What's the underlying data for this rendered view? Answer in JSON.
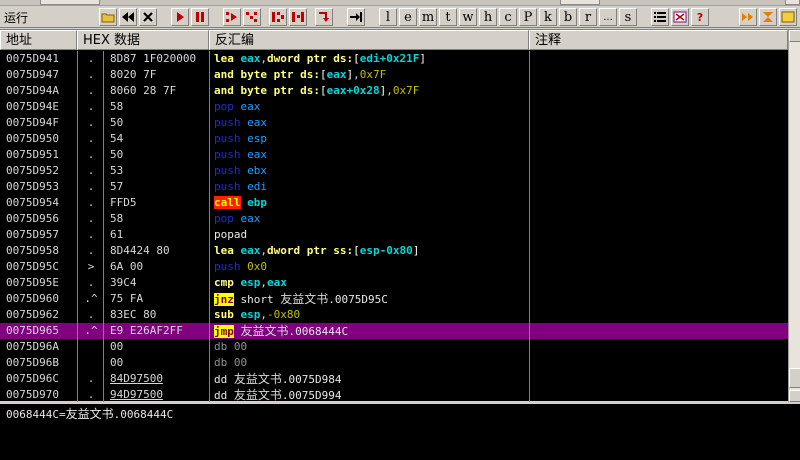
{
  "toolbar": {
    "status": "运行",
    "letters": [
      "l",
      "e",
      "m",
      "t",
      "w",
      "h",
      "c",
      "P",
      "k",
      "b",
      "r",
      "...",
      "s"
    ]
  },
  "columns": {
    "address": "地址",
    "hex": "HEX 数据",
    "disasm": "反汇编",
    "comment": "注释"
  },
  "rows": [
    {
      "addr": "0075D941",
      "mark": ".",
      "hex": "8D87 1F020000",
      "asm": [
        [
          "kw",
          "lea "
        ],
        [
          "reg",
          "eax"
        ],
        [
          "sep",
          ","
        ],
        [
          "kw",
          "dword ptr ds:"
        ],
        [
          "op",
          "["
        ],
        [
          "reg",
          "edi+0x21F"
        ],
        [
          "op",
          "]"
        ]
      ]
    },
    {
      "addr": "0075D947",
      "mark": ".",
      "hex": "8020 7F",
      "asm": [
        [
          "kw",
          "and "
        ],
        [
          "kw",
          "byte ptr ds:"
        ],
        [
          "op",
          "["
        ],
        [
          "reg",
          "eax"
        ],
        [
          "op",
          "]"
        ],
        [
          "sep",
          ","
        ],
        [
          "num",
          "0x7F"
        ]
      ]
    },
    {
      "addr": "0075D94A",
      "mark": ".",
      "hex": "8060 28 7F",
      "asm": [
        [
          "kw",
          "and "
        ],
        [
          "kw",
          "byte ptr ds:"
        ],
        [
          "op",
          "["
        ],
        [
          "reg",
          "eax+0x28"
        ],
        [
          "op",
          "]"
        ],
        [
          "sep",
          ","
        ],
        [
          "num",
          "0x7F"
        ]
      ]
    },
    {
      "addr": "0075D94E",
      "mark": ".",
      "hex": "58",
      "asm": [
        [
          "stack",
          "pop "
        ],
        [
          "stk-reg",
          "eax"
        ]
      ]
    },
    {
      "addr": "0075D94F",
      "mark": ".",
      "hex": "50",
      "asm": [
        [
          "stack",
          "push "
        ],
        [
          "stk-reg",
          "eax"
        ]
      ]
    },
    {
      "addr": "0075D950",
      "mark": ".",
      "hex": "54",
      "asm": [
        [
          "stack",
          "push "
        ],
        [
          "stk-reg",
          "esp"
        ]
      ]
    },
    {
      "addr": "0075D951",
      "mark": ".",
      "hex": "50",
      "asm": [
        [
          "stack",
          "push "
        ],
        [
          "stk-reg",
          "eax"
        ]
      ]
    },
    {
      "addr": "0075D952",
      "mark": ".",
      "hex": "53",
      "asm": [
        [
          "stack",
          "push "
        ],
        [
          "stk-reg",
          "ebx"
        ]
      ]
    },
    {
      "addr": "0075D953",
      "mark": ".",
      "hex": "57",
      "asm": [
        [
          "stack",
          "push "
        ],
        [
          "stk-reg",
          "edi"
        ]
      ]
    },
    {
      "addr": "0075D954",
      "mark": ".",
      "hex": "FFD5",
      "asm": [
        [
          "call-hl",
          "call"
        ],
        [
          "sep",
          " "
        ],
        [
          "reg",
          "ebp"
        ]
      ]
    },
    {
      "addr": "0075D956",
      "mark": ".",
      "hex": "58",
      "asm": [
        [
          "stack",
          "pop "
        ],
        [
          "stk-reg",
          "eax"
        ]
      ]
    },
    {
      "addr": "0075D957",
      "mark": ".",
      "hex": "61",
      "asm": [
        [
          "plain",
          "popad"
        ]
      ]
    },
    {
      "addr": "0075D958",
      "mark": ".",
      "hex": "8D4424 80",
      "asm": [
        [
          "kw",
          "lea "
        ],
        [
          "reg",
          "eax"
        ],
        [
          "sep",
          ","
        ],
        [
          "kw",
          "dword ptr ss:"
        ],
        [
          "op",
          "["
        ],
        [
          "reg",
          "esp-0x80"
        ],
        [
          "op",
          "]"
        ]
      ]
    },
    {
      "addr": "0075D95C",
      "mark": ">",
      "hex": "6A 00",
      "asm": [
        [
          "stack",
          "push "
        ],
        [
          "num",
          "0x0"
        ]
      ]
    },
    {
      "addr": "0075D95E",
      "mark": ".",
      "hex": "39C4",
      "asm": [
        [
          "kw",
          "cmp "
        ],
        [
          "reg",
          "esp"
        ],
        [
          "sep",
          ","
        ],
        [
          "reg",
          "eax"
        ]
      ]
    },
    {
      "addr": "0075D960",
      "mark": ".^",
      "hex": "75 FA",
      "asm": [
        [
          "jmp-hl",
          "jnz"
        ],
        [
          "plain",
          " short "
        ],
        [
          "cjk",
          "友益文书"
        ],
        [
          "plain",
          ".0075D95C"
        ]
      ]
    },
    {
      "addr": "0075D962",
      "mark": ".",
      "hex": "83EC 80",
      "asm": [
        [
          "kw",
          "sub "
        ],
        [
          "reg",
          "esp"
        ],
        [
          "sep",
          ","
        ],
        [
          "num",
          "-0x80"
        ]
      ]
    },
    {
      "addr": "0075D965",
      "mark": ".^",
      "hex": "E9 E26AF2FF",
      "selected": true,
      "asm": [
        [
          "jmp-hl",
          "jmp"
        ],
        [
          "plain",
          " "
        ],
        [
          "cjk",
          "友益文书"
        ],
        [
          "plain",
          ".0068444C"
        ]
      ]
    },
    {
      "addr": "0075D96A",
      "mark": "",
      "hex": "00",
      "asm": [
        [
          "db",
          "db 00"
        ]
      ]
    },
    {
      "addr": "0075D96B",
      "mark": "",
      "hex": "00",
      "asm": [
        [
          "db",
          "db 00"
        ]
      ]
    },
    {
      "addr": "0075D96C",
      "mark": ".",
      "hex": "84D97500",
      "ul": true,
      "asm": [
        [
          "plain",
          "dd "
        ],
        [
          "cjk",
          "友益文书"
        ],
        [
          "plain",
          ".0075D984"
        ]
      ]
    },
    {
      "addr": "0075D970",
      "mark": ".",
      "hex": "94D97500",
      "ul": true,
      "asm": [
        [
          "plain",
          "dd "
        ],
        [
          "cjk",
          "友益文书"
        ],
        [
          "plain",
          ".0075D994"
        ]
      ]
    }
  ],
  "info": {
    "prefix": "0068444C=",
    "module": "友益文书",
    "suffix": ".0068444C"
  }
}
